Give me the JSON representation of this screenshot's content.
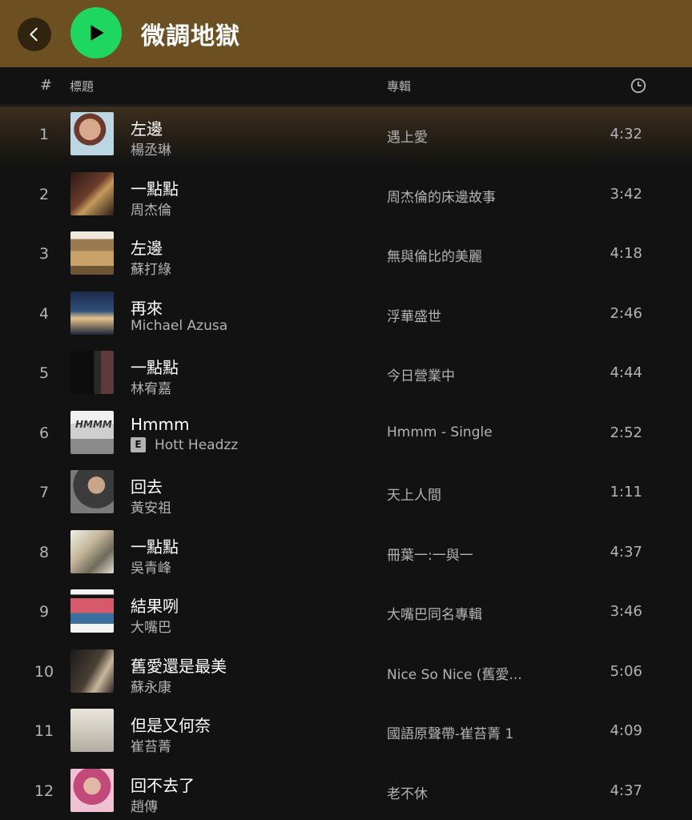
{
  "header": {
    "title": "微調地獄",
    "colors": {
      "background": "#6c5022",
      "play": "#1ed760"
    }
  },
  "columns": {
    "number": "#",
    "title": "標題",
    "album": "專輯"
  },
  "tracks": [
    {
      "number": "1",
      "title": "左邊",
      "artist": "楊丞琳",
      "album": "遇上愛",
      "duration": "4:32",
      "explicit": false
    },
    {
      "number": "2",
      "title": "一點點",
      "artist": "周杰倫",
      "album": "周杰倫的床邊故事",
      "duration": "3:42",
      "explicit": false
    },
    {
      "number": "3",
      "title": "左邊",
      "artist": "蘇打綠",
      "album": "無與倫比的美麗",
      "duration": "4:18",
      "explicit": false
    },
    {
      "number": "4",
      "title": "再來",
      "artist": "Michael Azusa",
      "album": "浮華盛世",
      "duration": "2:46",
      "explicit": false
    },
    {
      "number": "5",
      "title": "一點點",
      "artist": "林宥嘉",
      "album": "今日營業中",
      "duration": "4:44",
      "explicit": false
    },
    {
      "number": "6",
      "title": "Hmmm",
      "artist": "Hott Headzz",
      "album": "Hmmm - Single",
      "duration": "2:52",
      "explicit": true,
      "explicit_label": "E",
      "cover_text": "HMMM"
    },
    {
      "number": "7",
      "title": "回去",
      "artist": "黃安祖",
      "album": "天上人間",
      "duration": "1:11",
      "explicit": false
    },
    {
      "number": "8",
      "title": "一點點",
      "artist": "吳青峰",
      "album": "冊葉一:一與一",
      "duration": "4:37",
      "explicit": false
    },
    {
      "number": "9",
      "title": "結果咧",
      "artist": "大嘴巴",
      "album": "大嘴巴同名專輯",
      "duration": "3:46",
      "explicit": false
    },
    {
      "number": "10",
      "title": "舊愛還是最美",
      "artist": "蘇永康",
      "album": "Nice So Nice (舊愛...",
      "duration": "5:06",
      "explicit": false
    },
    {
      "number": "11",
      "title": "但是又何奈",
      "artist": "崔苔菁",
      "album": "國語原聲帶-崔苔菁 1",
      "duration": "4:09",
      "explicit": false
    },
    {
      "number": "12",
      "title": "回不去了",
      "artist": "趙傳",
      "album": "老不休",
      "duration": "4:37",
      "explicit": false
    }
  ]
}
